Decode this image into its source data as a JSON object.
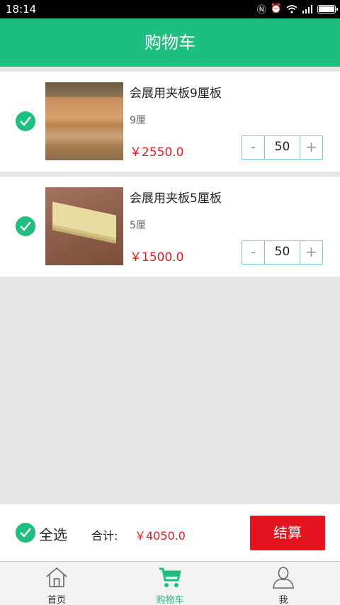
{
  "status_bar": {
    "time": "18:14"
  },
  "header": {
    "title": "购物车"
  },
  "cart": {
    "items": [
      {
        "name": "会展用夹板9厘板",
        "spec": "9厘",
        "price": "￥2550.0",
        "quantity": "50",
        "minus": "-",
        "plus": "+"
      },
      {
        "name": "会展用夹板5厘板",
        "spec": "5厘",
        "price": "￥1500.0",
        "quantity": "50",
        "minus": "-",
        "plus": "+"
      }
    ]
  },
  "checkout": {
    "select_all_label": "全选",
    "total_label": "合计:",
    "total_value": "￥4050.0",
    "checkout_button": "结算"
  },
  "tabs": [
    {
      "label": "首页",
      "icon": "home-icon"
    },
    {
      "label": "购物车",
      "icon": "cart-icon",
      "active": true
    },
    {
      "label": "我",
      "icon": "user-icon"
    }
  ],
  "colors": {
    "brand": "#1dbf7e",
    "price": "#e51c23",
    "checkout_button": "#e6141e"
  }
}
